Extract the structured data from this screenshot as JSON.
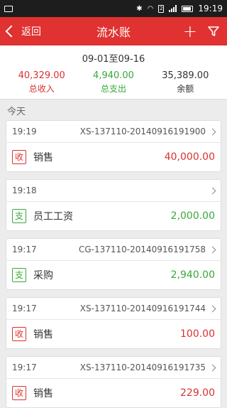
{
  "status_bar": {
    "time": "19:19",
    "sim_label": "2"
  },
  "header": {
    "back_label": "返回",
    "title": "流水账"
  },
  "summary": {
    "date_range": "09-01至09-16",
    "income_value": "40,329.00",
    "income_label": "总收入",
    "expense_value": "4,940.00",
    "expense_label": "总支出",
    "balance_value": "35,389.00",
    "balance_label": "余额"
  },
  "section_title": "今天",
  "records": [
    {
      "time": "19:19",
      "code": "XS-137110-20140916191900",
      "badge": "收",
      "category": "销售",
      "amount": "40,000.00"
    },
    {
      "time": "19:18",
      "code": "",
      "badge": "支",
      "category": "员工工资",
      "amount": "2,000.00"
    },
    {
      "time": "19:17",
      "code": "CG-137110-20140916191758",
      "badge": "支",
      "category": "采购",
      "amount": "2,940.00"
    },
    {
      "time": "19:17",
      "code": "XS-137110-20140916191744",
      "badge": "收",
      "category": "销售",
      "amount": "100.00"
    },
    {
      "time": "19:17",
      "code": "XS-137110-20140916191735",
      "badge": "收",
      "category": "销售",
      "amount": "229.00"
    }
  ],
  "colors": {
    "header_bg": "#e03230",
    "income": "#d9322f",
    "expense": "#39a83a"
  },
  "icons": {
    "back": "chevron-left-icon",
    "add": "plus-icon",
    "filter": "filter-funnel-icon"
  }
}
